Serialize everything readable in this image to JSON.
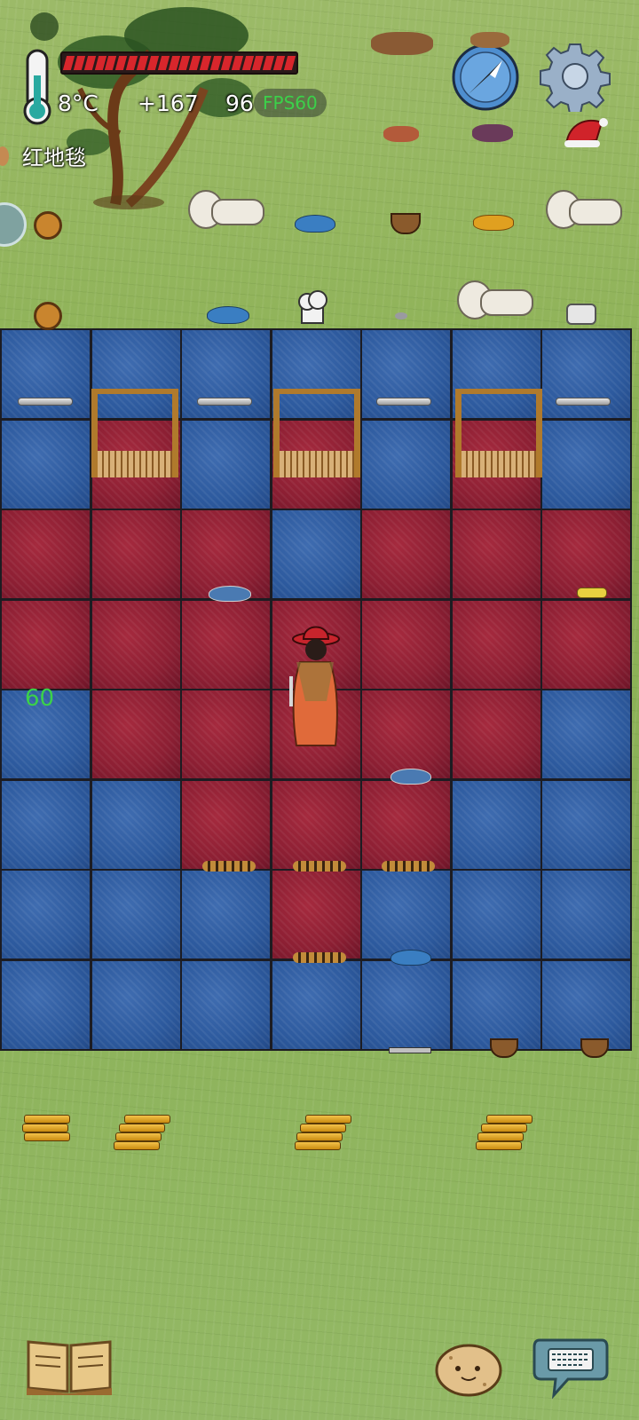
{
  "hud": {
    "temperature": "8°C",
    "yum_bonus": "+167",
    "age": "96",
    "fps_badge": "FPS60",
    "hovered_object": "红地毯",
    "side_fps": "60",
    "health_segments": 22
  },
  "icons": {
    "thermometer": "thermometer-icon",
    "compass": "compass-icon",
    "settings": "gear-icon",
    "tech_book": "book-icon",
    "emote": "potato-face-icon",
    "chat": "keyboard-chat-icon"
  },
  "colors": {
    "health_red": "#d8262c",
    "carpet_red": "#8c1f33",
    "carpet_blue": "#2d5a9e",
    "grass": "#8db256",
    "fps_green": "#3bd14a"
  },
  "carpet_grid": [
    [
      "blue",
      "blue",
      "blue",
      "blue",
      "blue",
      "blue",
      "blue"
    ],
    [
      "blue",
      "red",
      "blue",
      "red",
      "blue",
      "red",
      "blue"
    ],
    [
      "red",
      "red",
      "red",
      "blue",
      "red",
      "red",
      "red"
    ],
    [
      "red",
      "red",
      "red",
      "red",
      "red",
      "red",
      "red"
    ],
    [
      "blue",
      "red",
      "red",
      "red",
      "red",
      "red",
      "blue"
    ],
    [
      "blue",
      "blue",
      "red",
      "red",
      "red",
      "blue",
      "blue"
    ],
    [
      "blue",
      "blue",
      "blue",
      "red",
      "blue",
      "blue",
      "blue"
    ],
    [
      "blue",
      "blue",
      "blue",
      "blue",
      "blue",
      "blue",
      "blue"
    ]
  ]
}
